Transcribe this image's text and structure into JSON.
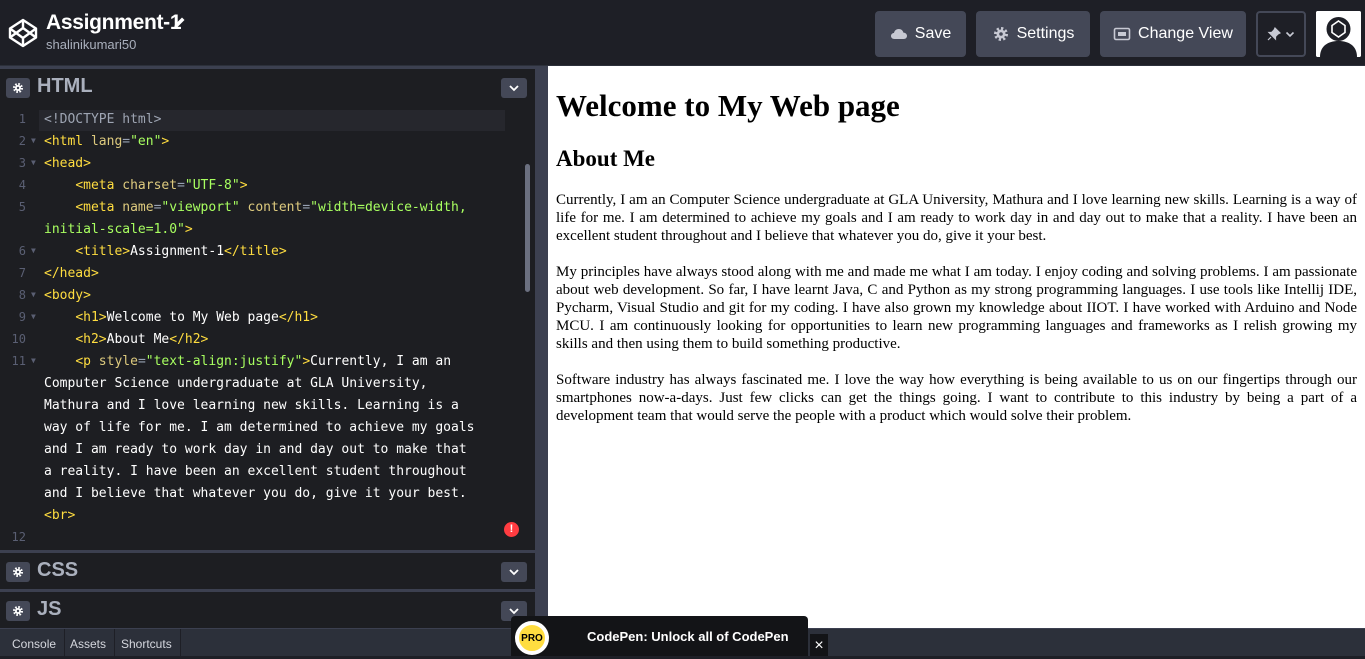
{
  "header": {
    "title": "Assignment-1",
    "username": "shalinikumari50",
    "save_label": "Save",
    "settings_label": "Settings",
    "change_view_label": "Change View"
  },
  "editors": {
    "html_title": "HTML",
    "css_title": "CSS",
    "js_title": "JS"
  },
  "code": {
    "line_numbers": [
      "1",
      "2",
      "3",
      "4",
      "5",
      "",
      "6",
      "7",
      "8",
      "9",
      "10",
      "11",
      "",
      "",
      "",
      "",
      "",
      "",
      "12"
    ],
    "l1": "<!DOCTYPE html>",
    "l2_open": "<html",
    "l2_attr": " lang",
    "l2_eq": "=",
    "l2_str": "\"en\"",
    "l2_close": ">",
    "l3": "<head>",
    "l4_open": "<meta",
    "l4_attr": " charset",
    "l4_eq": "=",
    "l4_str": "\"UTF-8\"",
    "l4_close": ">",
    "l5_open": "<meta",
    "l5_attr1": " name",
    "l5_eq1": "=",
    "l5_str1": "\"viewport\"",
    "l5_attr2": " content",
    "l5_eq2": "=",
    "l5_str2": "\"width=device-width,",
    "l5b_str": "initial-scale=1.0\"",
    "l5b_close": ">",
    "l6_open": "<title>",
    "l6_text": "Assignment-1",
    "l6_close": "</title>",
    "l7": "</head>",
    "l8": "<body>",
    "l9_open": "<h1>",
    "l9_text": "Welcome to My Web page",
    "l9_close": "</h1>",
    "l10_open": "<h2>",
    "l10_text": "About Me",
    "l10_close": "</h2>",
    "l11_open": "<p",
    "l11_attr": " style",
    "l11_eq": "=",
    "l11_str": "\"text-align:justify\"",
    "l11_close": ">",
    "l11_text": "Currently, I am an",
    "wrap1": "Computer Science undergraduate at GLA University,",
    "wrap2": "Mathura and I love learning new skills. Learning is a",
    "wrap3": "way of life for me. I am determined to achieve my goals",
    "wrap4": "and I am ready to work day in and day out to make that",
    "wrap5": "a reality. I have been an excellent student throughout",
    "wrap6": "and I believe that whatever you do, give it your best.",
    "wrap7": "<br>",
    "error_icon": "!"
  },
  "preview": {
    "h1": "Welcome to My Web page",
    "h2": "About Me",
    "p1": "Currently, I am an Computer Science undergraduate at GLA University, Mathura and I love learning new skills. Learning is a way of life for me. I am determined to achieve my goals and I am ready to work day in and day out to make that a reality. I have been an excellent student throughout and I believe that whatever you do, give it your best.",
    "p2": "My principles have always stood along with me and made me what I am today. I enjoy coding and solving problems. I am passionate about web development. So far, I have learnt Java, C and Python as my strong programming languages. I use tools like Intellij IDE, Pycharm, Visual Studio and git for my coding. I have also grown my knowledge about IIOT. I have worked with Arduino and Node MCU. I am continuously looking for opportunities to learn new programming languages and frameworks as I relish growing my skills and then using them to build something productive.",
    "p3": "Software industry has always fascinated me. I love the way how everything is being available to us on our fingertips through our smartphones now-a-days. Just few clicks can get the things going. I want to contribute to this industry by being a part of a development team that would serve the people with a product which would solve their problem."
  },
  "bottom": {
    "console": "Console",
    "assets": "Assets",
    "shortcuts": "Shortcuts",
    "promo_badge": "PRO",
    "promo_text": "CodePen: Unlock all of CodePen",
    "close": "×"
  },
  "colors": {
    "accent_bg": "#1e1f26",
    "button_bg": "#444857",
    "tag": "#ffdd40",
    "string": "#a8ff60",
    "attr": "#ddca7e",
    "error": "#ff3c41"
  }
}
